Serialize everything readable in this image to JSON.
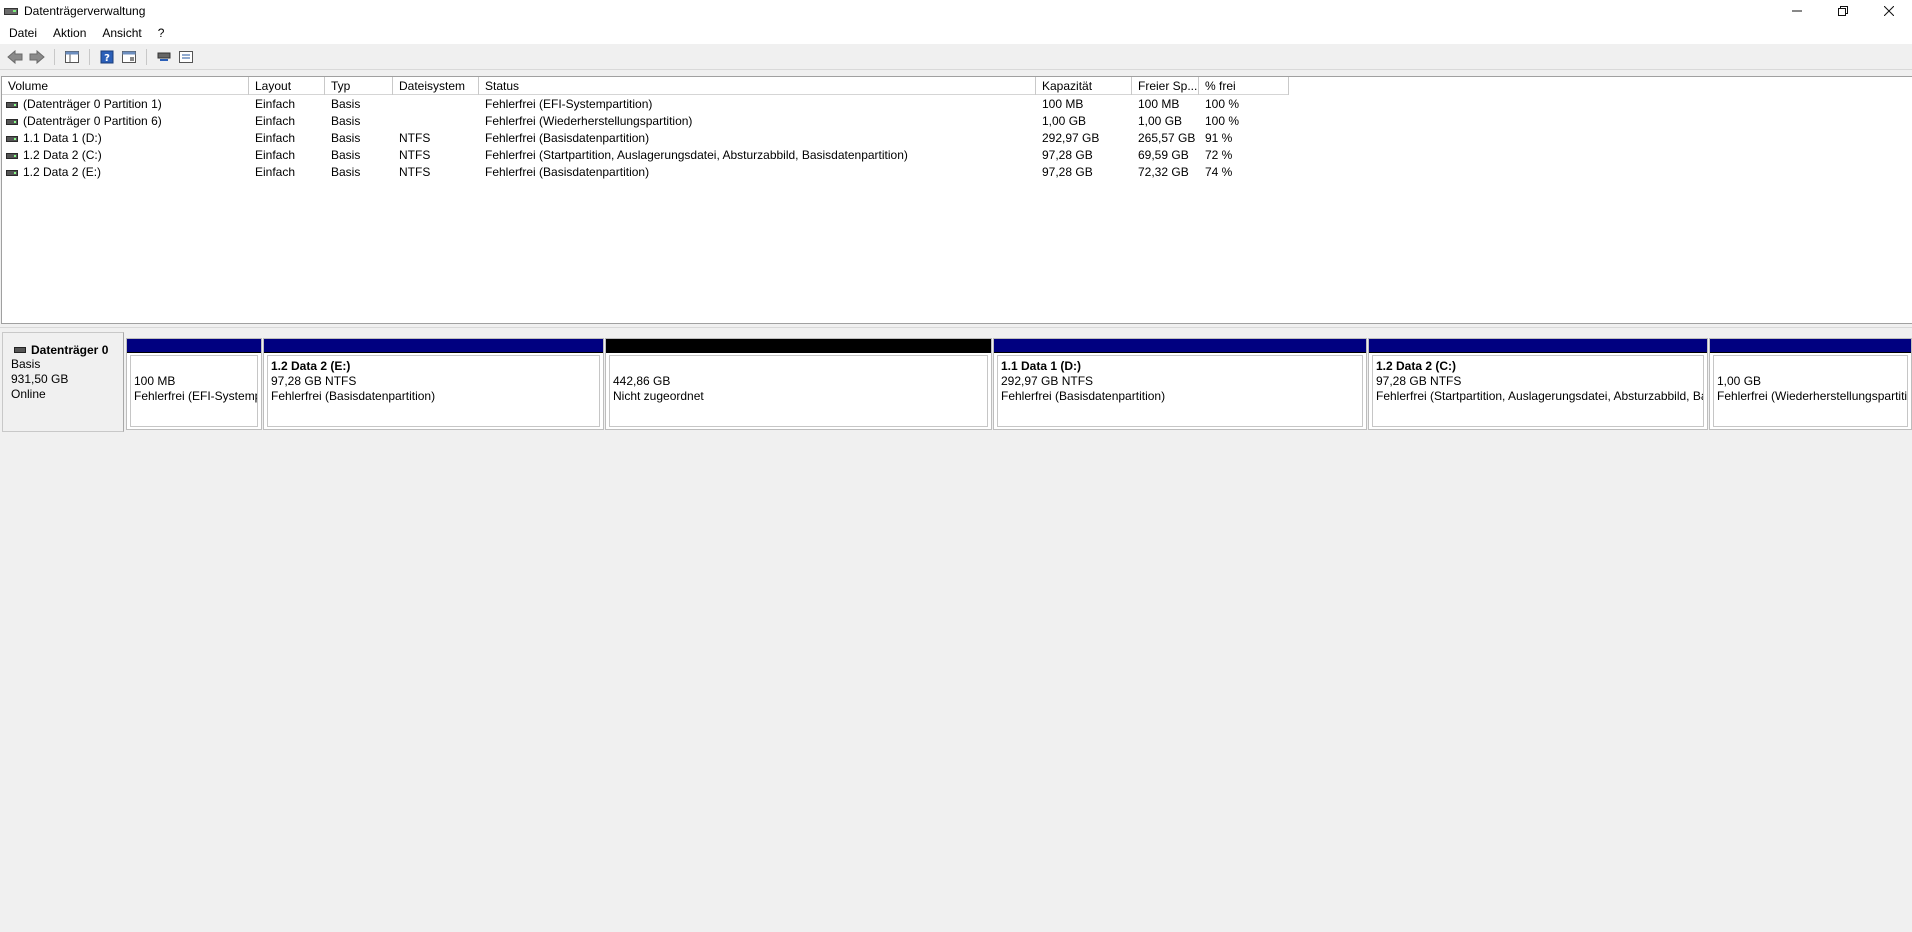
{
  "window": {
    "title": "Datenträgerverwaltung",
    "icon": "disk-management-icon"
  },
  "menu": [
    "Datei",
    "Aktion",
    "Ansicht",
    "?"
  ],
  "toolbar": {
    "buttons": [
      "back-arrow-icon",
      "forward-arrow-icon",
      "console-tree-icon",
      "help-icon",
      "properties-icon",
      "rescan-icon",
      "settings-icon"
    ]
  },
  "volume_list": {
    "columns": [
      "Volume",
      "Layout",
      "Typ",
      "Dateisystem",
      "Status",
      "Kapazität",
      "Freier Sp...",
      "% frei"
    ],
    "rows": [
      [
        "(Datenträger 0 Partition 1)",
        "Einfach",
        "Basis",
        "",
        "Fehlerfrei (EFI-Systempartition)",
        "100 MB",
        "100 MB",
        "100 %"
      ],
      [
        "(Datenträger 0 Partition 6)",
        "Einfach",
        "Basis",
        "",
        "Fehlerfrei (Wiederherstellungspartition)",
        "1,00 GB",
        "1,00 GB",
        "100 %"
      ],
      [
        "1.1 Data 1 (D:)",
        "Einfach",
        "Basis",
        "NTFS",
        "Fehlerfrei (Basisdatenpartition)",
        "292,97 GB",
        "265,57 GB",
        "91 %"
      ],
      [
        "1.2 Data 2 (C:)",
        "Einfach",
        "Basis",
        "NTFS",
        "Fehlerfrei (Startpartition, Auslagerungsdatei, Absturzabbild, Basisdatenpartition)",
        "97,28 GB",
        "69,59 GB",
        "72 %"
      ],
      [
        "1.2 Data 2 (E:)",
        "Einfach",
        "Basis",
        "NTFS",
        "Fehlerfrei (Basisdatenpartition)",
        "97,28 GB",
        "72,32 GB",
        "74 %"
      ]
    ]
  },
  "disk": {
    "name": "Datenträger 0",
    "type": "Basis",
    "size": "931,50 GB",
    "state": "Online",
    "colors": {
      "primary": "#000080",
      "unallocated": "#000000"
    },
    "partitions": [
      {
        "name": "",
        "size": "100 MB",
        "status": "Fehlerfrei (EFI-Systemp",
        "unallocated": false
      },
      {
        "name": "1.2 Data 2  (E:)",
        "size": "97,28 GB NTFS",
        "status": "Fehlerfrei (Basisdatenpartition)",
        "unallocated": false
      },
      {
        "name": "",
        "size": "442,86 GB",
        "status": "Nicht zugeordnet",
        "unallocated": true
      },
      {
        "name": "1.1 Data 1  (D:)",
        "size": "292,97 GB NTFS",
        "status": "Fehlerfrei (Basisdatenpartition)",
        "unallocated": false
      },
      {
        "name": "1.2 Data 2  (C:)",
        "size": "97,28 GB NTFS",
        "status": "Fehlerfrei (Startpartition, Auslagerungsdatei, Absturzabbild, Ba",
        "unallocated": false
      },
      {
        "name": "",
        "size": "1,00 GB",
        "status": "Fehlerfrei (Wiederherstellungspartitic",
        "unallocated": false
      }
    ]
  }
}
